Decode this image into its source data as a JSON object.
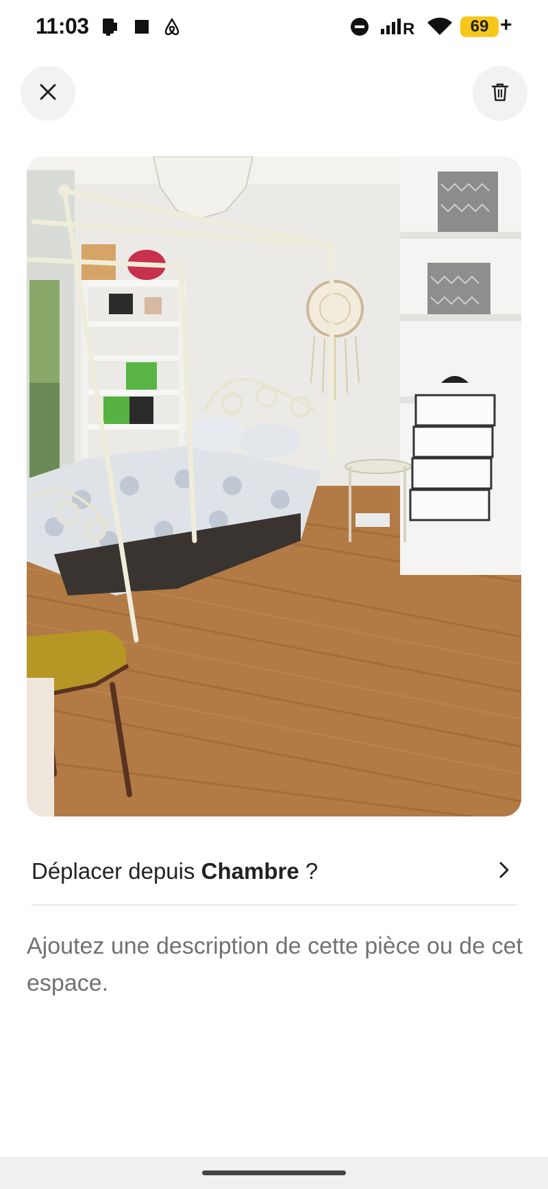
{
  "status_bar": {
    "time": "11:03",
    "battery": "69",
    "battery_suffix": "+",
    "icons": [
      "tablet-icon",
      "stop-square-icon",
      "airbnb-icon",
      "do-not-disturb-icon",
      "signal-icon",
      "wifi-icon",
      "battery-icon"
    ]
  },
  "header": {
    "close_icon": "close-icon",
    "delete_icon": "trash-icon"
  },
  "photo": {
    "subject": "bedroom-photo"
  },
  "move_row": {
    "prefix": "Déplacer depuis ",
    "room": "Chambre",
    "suffix": " ?",
    "chevron_icon": "chevron-right-icon"
  },
  "description": {
    "placeholder": "Ajoutez une description de cette pièce ou de cet espace."
  },
  "colors": {
    "battery": "#f7c61b",
    "button_bg": "#f2f2f2",
    "placeholder_text": "#717171",
    "divider": "#e6e6e6"
  }
}
